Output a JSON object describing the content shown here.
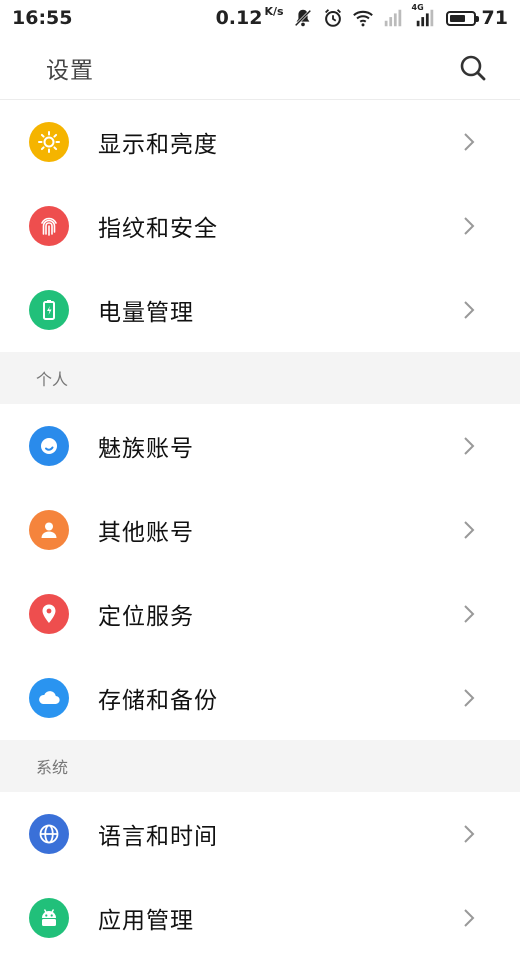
{
  "status_bar": {
    "time": "16:55",
    "speed": "0.12",
    "speed_unit": "K/s",
    "net_label": "4G",
    "battery": "71",
    "battery_level": 0.71
  },
  "header": {
    "title": "设置",
    "search_icon": "search-icon"
  },
  "rows_top": [
    {
      "label": "显示和亮度",
      "icon": "sun-icon",
      "color": "#F5B400"
    },
    {
      "label": "指纹和安全",
      "icon": "fingerprint-icon",
      "color": "#EE4E4E"
    },
    {
      "label": "电量管理",
      "icon": "battery-icon",
      "color": "#21C07A"
    }
  ],
  "section_personal": {
    "title": "个人"
  },
  "rows_personal": [
    {
      "label": "魅族账号",
      "icon": "account-circle-icon",
      "color": "#2A8BEB"
    },
    {
      "label": "其他账号",
      "icon": "person-icon",
      "color": "#F5843C"
    },
    {
      "label": "定位服务",
      "icon": "location-pin-icon",
      "color": "#EE4E4E"
    },
    {
      "label": "存储和备份",
      "icon": "cloud-icon",
      "color": "#2A94F0"
    }
  ],
  "section_system": {
    "title": "系统"
  },
  "rows_system": [
    {
      "label": "语言和时间",
      "icon": "globe-icon",
      "color": "#3A70D8"
    },
    {
      "label": "应用管理",
      "icon": "android-icon",
      "color": "#21C07A"
    }
  ]
}
